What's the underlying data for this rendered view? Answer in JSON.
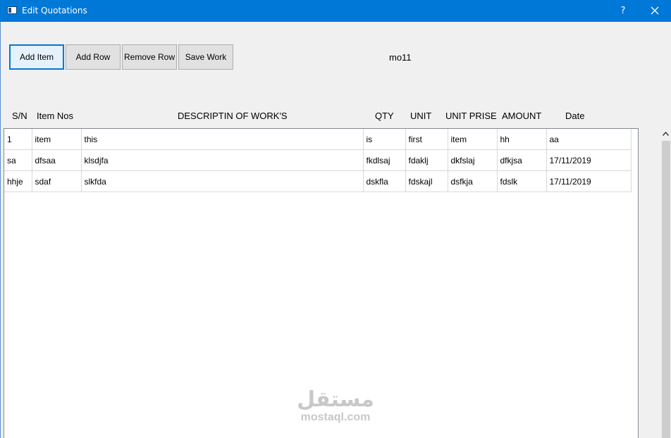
{
  "window": {
    "title": "Edit Quotations",
    "help_label": "?",
    "accent_color": "#0078d7"
  },
  "toolbar": {
    "add_item_label": "Add Item",
    "add_row_label": "Add Row",
    "remove_row_label": "Remove Row",
    "save_work_label": "Save Work",
    "status_label": "mo11"
  },
  "columns": [
    "S/N",
    "Item Nos",
    "DESCRIPTIN OF WORK'S",
    "QTY",
    "UNIT",
    "UNIT PRISE",
    "AMOUNT",
    "Date"
  ],
  "rows": [
    [
      "1",
      "item",
      "this",
      "is",
      "first",
      "item",
      "hh",
      "aa"
    ],
    [
      "sa",
      "dfsaa",
      "klsdjfa",
      "fkdlsaj",
      "fdaklj",
      "dkfslaj",
      "dfkjsa",
      "17/11/2019"
    ],
    [
      "hhje",
      "sdaf",
      "slkfda",
      "dskfla",
      "fdskajl",
      "dsfkja",
      "fdslk",
      "17/11/2019"
    ]
  ],
  "watermark": {
    "arabic": "مستقل",
    "latin": "mostaql.com"
  }
}
